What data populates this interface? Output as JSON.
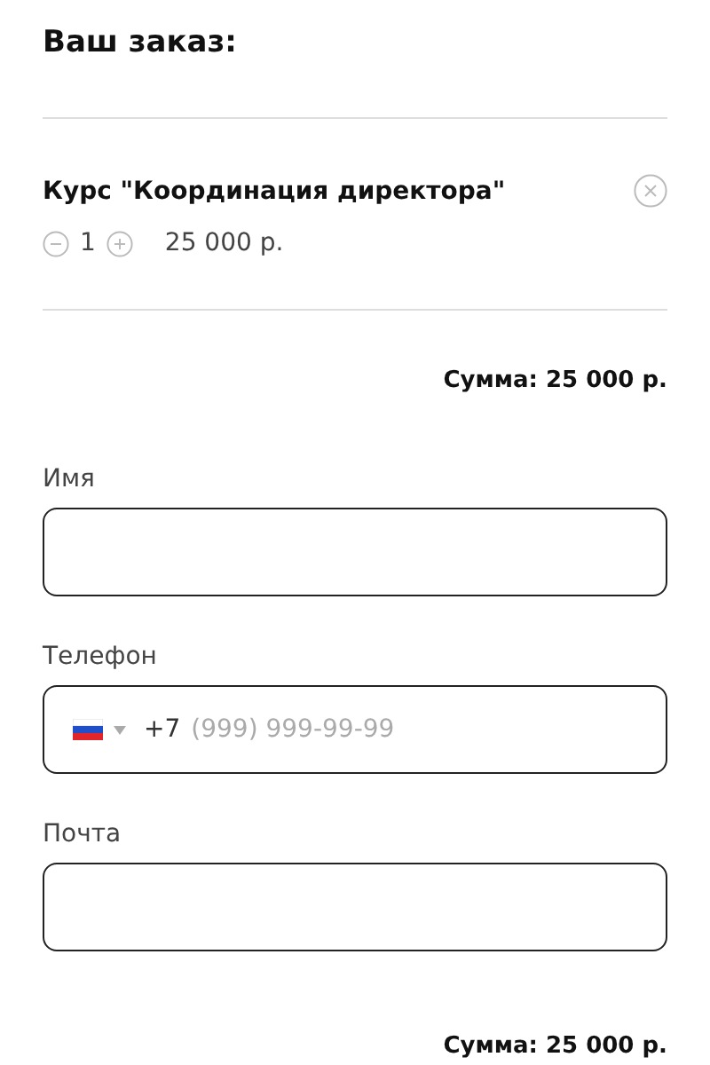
{
  "title": "Ваш заказ:",
  "items": [
    {
      "name": "Курс \"Координация директора\"",
      "quantity": "1",
      "price": "25 000 р."
    }
  ],
  "total_top": "Сумма: 25 000 р.",
  "fields": [
    {
      "kind": "text",
      "label": "Имя"
    },
    {
      "kind": "phone",
      "label": "Телефон",
      "prefix": "+7",
      "placeholder": "(999) 999-99-99"
    },
    {
      "kind": "text",
      "label": "Почта"
    }
  ],
  "total_bottom": "Сумма: 25 000 р."
}
